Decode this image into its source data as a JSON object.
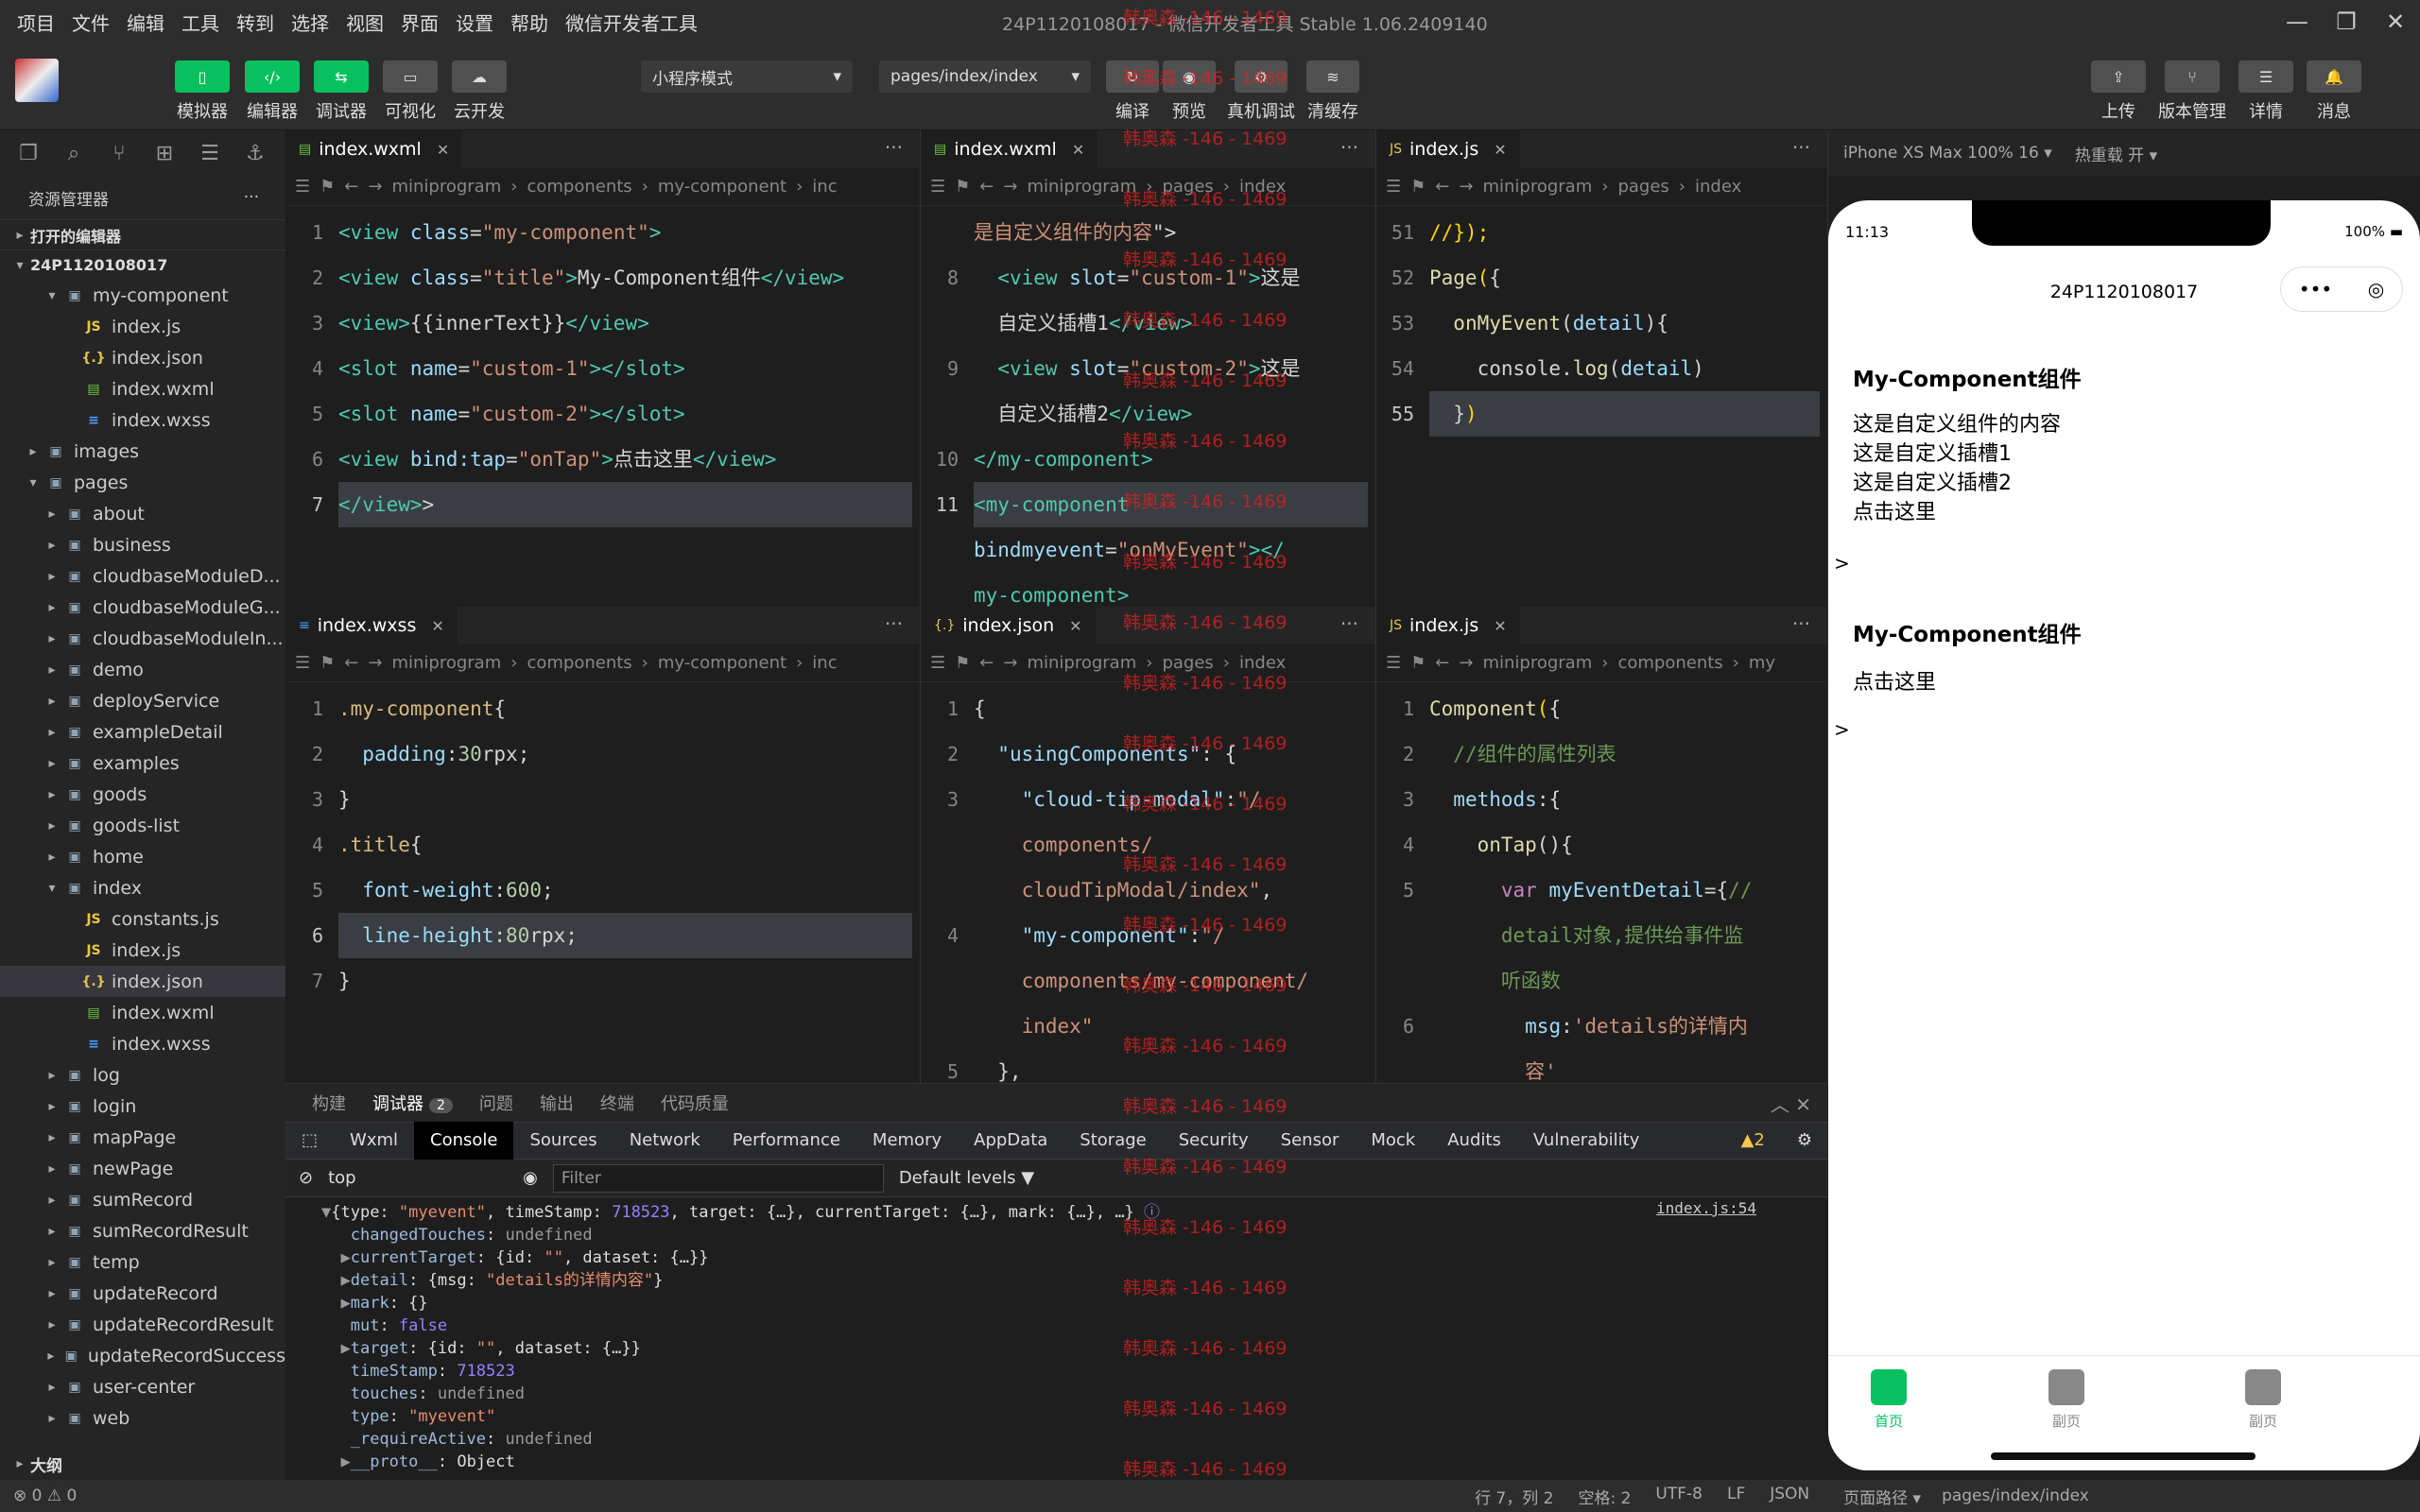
{
  "menu": [
    "项目",
    "文件",
    "编辑",
    "工具",
    "转到",
    "选择",
    "视图",
    "界面",
    "设置",
    "帮助",
    "微信开发者工具"
  ],
  "window_title": "24P1120108017 - 微信开发者工具 Stable 1.06.2409140",
  "toolbar": {
    "left": [
      {
        "icon": "▯",
        "label": "模拟器"
      },
      {
        "icon": "‹/›",
        "label": "编辑器"
      },
      {
        "icon": "⇆",
        "label": "调试器"
      },
      {
        "icon": "▭",
        "label": "可视化"
      },
      {
        "icon": "☁",
        "label": "云开发"
      }
    ],
    "mode": "小程序模式",
    "page": "pages/index/index",
    "mid": [
      {
        "label": "编译"
      },
      {
        "label": "预览"
      },
      {
        "label": "真机调试"
      },
      {
        "label": "清缓存"
      }
    ],
    "right": [
      {
        "label": "上传"
      },
      {
        "label": "版本管理"
      },
      {
        "label": "详情"
      },
      {
        "label": "消息"
      }
    ]
  },
  "explorer": {
    "title": "资源管理器",
    "open_editors": "打开的编辑器",
    "project": "24P1120108017",
    "tree": [
      {
        "name": "my-component",
        "indent": 2,
        "type": "folder",
        "open": true
      },
      {
        "name": "index.js",
        "indent": 3,
        "type": "js"
      },
      {
        "name": "index.json",
        "indent": 3,
        "type": "json"
      },
      {
        "name": "index.wxml",
        "indent": 3,
        "type": "wxml"
      },
      {
        "name": "index.wxss",
        "indent": 3,
        "type": "wxss"
      },
      {
        "name": "images",
        "indent": 1,
        "type": "folder"
      },
      {
        "name": "pages",
        "indent": 1,
        "type": "folder",
        "open": true
      },
      {
        "name": "about",
        "indent": 2,
        "type": "folder"
      },
      {
        "name": "business",
        "indent": 2,
        "type": "folder"
      },
      {
        "name": "cloudbaseModuleD...",
        "indent": 2,
        "type": "folder"
      },
      {
        "name": "cloudbaseModuleG...",
        "indent": 2,
        "type": "folder"
      },
      {
        "name": "cloudbaseModuleIn...",
        "indent": 2,
        "type": "folder"
      },
      {
        "name": "demo",
        "indent": 2,
        "type": "folder"
      },
      {
        "name": "deployService",
        "indent": 2,
        "type": "folder"
      },
      {
        "name": "exampleDetail",
        "indent": 2,
        "type": "folder"
      },
      {
        "name": "examples",
        "indent": 2,
        "type": "folder"
      },
      {
        "name": "goods",
        "indent": 2,
        "type": "folder"
      },
      {
        "name": "goods-list",
        "indent": 2,
        "type": "folder"
      },
      {
        "name": "home",
        "indent": 2,
        "type": "folder"
      },
      {
        "name": "index",
        "indent": 2,
        "type": "folder",
        "open": true
      },
      {
        "name": "constants.js",
        "indent": 3,
        "type": "js"
      },
      {
        "name": "index.js",
        "indent": 3,
        "type": "js"
      },
      {
        "name": "index.json",
        "indent": 3,
        "type": "json",
        "selected": true
      },
      {
        "name": "index.wxml",
        "indent": 3,
        "type": "wxml"
      },
      {
        "name": "index.wxss",
        "indent": 3,
        "type": "wxss"
      },
      {
        "name": "log",
        "indent": 2,
        "type": "folder"
      },
      {
        "name": "login",
        "indent": 2,
        "type": "folder"
      },
      {
        "name": "mapPage",
        "indent": 2,
        "type": "folder"
      },
      {
        "name": "newPage",
        "indent": 2,
        "type": "folder"
      },
      {
        "name": "sumRecord",
        "indent": 2,
        "type": "folder"
      },
      {
        "name": "sumRecordResult",
        "indent": 2,
        "type": "folder"
      },
      {
        "name": "temp",
        "indent": 2,
        "type": "folder"
      },
      {
        "name": "updateRecord",
        "indent": 2,
        "type": "folder"
      },
      {
        "name": "updateRecordResult",
        "indent": 2,
        "type": "folder"
      },
      {
        "name": "updateRecordSuccess",
        "indent": 2,
        "type": "folder"
      },
      {
        "name": "user-center",
        "indent": 2,
        "type": "folder"
      },
      {
        "name": "web",
        "indent": 2,
        "type": "folder"
      }
    ],
    "outline": "大纲"
  },
  "panes": {
    "p1": {
      "tab": "index.wxml",
      "crumb": [
        "miniprogram",
        "components",
        "my-component",
        "inc"
      ],
      "lines": [
        {
          "n": "1",
          "h": "<span class='tag'>&lt;view</span> <span class='attr'>class</span>=<span class='str'>\"my-component\"</span><span class='tag'>&gt;</span>"
        },
        {
          "n": "2",
          "h": "<span class='tag'>&lt;view</span> <span class='attr'>class</span>=<span class='str'>\"title\"</span><span class='tag'>&gt;</span>My-Component组件<span class='tag'>&lt;/view&gt;</span>"
        },
        {
          "n": "3",
          "h": "<span class='tag'>&lt;view&gt;</span>{{innerText}}<span class='tag'>&lt;/view&gt;</span>"
        },
        {
          "n": "4",
          "h": "<span class='tag'>&lt;slot</span> <span class='attr'>name</span>=<span class='str'>\"custom-1\"</span><span class='tag'>&gt;&lt;/slot&gt;</span>"
        },
        {
          "n": "5",
          "h": "<span class='tag'>&lt;slot</span> <span class='attr'>name</span>=<span class='str'>\"custom-2\"</span><span class='tag'>&gt;&lt;/slot&gt;</span>"
        },
        {
          "n": "6",
          "h": "<span class='tag'>&lt;view</span> <span class='attr'>bind:tap</span>=<span class='str'>\"onTap\"</span><span class='tag'>&gt;</span>点击这里<span class='tag'>&lt;/view&gt;</span>"
        },
        {
          "n": "7",
          "h": "<span class='tag'>&lt;/view&gt;</span>&gt;",
          "cur": true
        }
      ]
    },
    "p2": {
      "tab": "index.wxml",
      "crumb": [
        "miniprogram",
        "pages",
        "index"
      ],
      "lines": [
        {
          "n": "",
          "h": "<span class='str'>是自定义组件的内容</span>\"&gt;"
        },
        {
          "n": "8",
          "h": "  <span class='tag'>&lt;view</span> <span class='attr'>slot</span>=<span class='str'>\"custom-1\"</span><span class='tag'>&gt;</span>这是"
        },
        {
          "n": "",
          "h": "  自定义插槽1<span class='tag'>&lt;/view&gt;</span>"
        },
        {
          "n": "9",
          "h": "  <span class='tag'>&lt;view</span> <span class='attr'>slot</span>=<span class='str'>\"custom-2\"</span><span class='tag'>&gt;</span>这是"
        },
        {
          "n": "",
          "h": "  自定义插槽2<span class='tag'>&lt;/view&gt;</span>"
        },
        {
          "n": "10",
          "h": "<span class='tag'>&lt;/my-component&gt;</span>"
        },
        {
          "n": "11",
          "h": "<span class='tag'>&lt;my-component</span>",
          "cur": true
        },
        {
          "n": "",
          "h": "<span class='attr'>bindmyevent</span>=<span class='str'>\"onMyEvent\"</span><span class='tag'>&gt;&lt;/</span>"
        },
        {
          "n": "",
          "h": "<span class='tag'>my-component&gt;</span>"
        }
      ]
    },
    "p3": {
      "tab": "index.js",
      "crumb": [
        "miniprogram",
        "pages",
        "index"
      ],
      "lines": [
        {
          "n": "51",
          "h": "<span class='pl'>//});</span>"
        },
        {
          "n": "52",
          "h": "<span class='fn'>Page</span><span class='pl'>(</span>{"
        },
        {
          "n": "53",
          "h": "  <span class='fn'>onMyEvent</span>(<span class='attr'>detail</span>){"
        },
        {
          "n": "54",
          "h": "    console.<span class='fn'>log</span>(<span class='attr'>detail</span>)"
        },
        {
          "n": "55",
          "h": "  }<span class='pl'>)</span>",
          "cur": true
        }
      ]
    },
    "p4": {
      "tab": "index.wxss",
      "crumb": [
        "miniprogram",
        "components",
        "my-component",
        "inc"
      ],
      "lines": [
        {
          "n": "1",
          "h": "<span class='sel2'>.my-component</span>{"
        },
        {
          "n": "2",
          "h": "  <span class='prop'>padding</span>:<span class='num'>30</span>rpx;"
        },
        {
          "n": "3",
          "h": "}"
        },
        {
          "n": "4",
          "h": "<span class='sel2'>.title</span>{"
        },
        {
          "n": "5",
          "h": "  <span class='prop'>font-weight</span>:<span class='num'>600</span>;"
        },
        {
          "n": "6",
          "h": "  <span class='prop'>line-height</span>:<span class='num'>80</span>rpx;",
          "cur": true
        },
        {
          "n": "7",
          "h": "}"
        }
      ]
    },
    "p5": {
      "tab": "index.json",
      "crumb": [
        "miniprogram",
        "pages",
        "index"
      ],
      "lines": [
        {
          "n": "1",
          "h": "{"
        },
        {
          "n": "2",
          "h": "  <span class='attr'>\"usingComponents\"</span>: {"
        },
        {
          "n": "3",
          "h": "    <span class='attr'>\"cloud-tip-modal\"</span>:<span class='str'>\"/</span>"
        },
        {
          "n": "",
          "h": "    <span class='str'>components/</span>"
        },
        {
          "n": "",
          "h": "    <span class='str'>cloudTipModal/index\"</span>,"
        },
        {
          "n": "4",
          "h": "    <span class='attr'>\"my-component\"</span>:<span class='str'>\"/</span>"
        },
        {
          "n": "",
          "h": "    <span class='str'>components/my-component/</span>"
        },
        {
          "n": "",
          "h": "    <span class='str'>index\"</span>"
        },
        {
          "n": "5",
          "h": "  },"
        }
      ]
    },
    "p6": {
      "tab": "index.js",
      "crumb": [
        "miniprogram",
        "components",
        "my"
      ],
      "lines": [
        {
          "n": "1",
          "h": "<span class='fn'>Component</span><span class='pl'>(</span>{"
        },
        {
          "n": "2",
          "h": "  <span class='cm'>//组件的属性列表</span>"
        },
        {
          "n": "3",
          "h": "  <span class='attr'>methods</span>:{"
        },
        {
          "n": "4",
          "h": "    <span class='fn'>onTap</span>(){"
        },
        {
          "n": "5",
          "h": "      <span class='kw'>var</span> <span class='attr'>myEventDetail</span>={<span class='cm'>//</span>"
        },
        {
          "n": "",
          "h": "      <span class='cm'>detail对象,提供给事件监</span>"
        },
        {
          "n": "",
          "h": "      <span class='cm'>听函数</span>"
        },
        {
          "n": "6",
          "h": "        <span class='attr'>msg</span>:<span class='str'>'details的详情内</span>"
        },
        {
          "n": "",
          "h": "        <span class='str'>容'</span>"
        }
      ]
    }
  },
  "panel": {
    "tabs": [
      "构建",
      "调试器",
      "问题",
      "输出",
      "终端",
      "代码质量"
    ],
    "badge": "2",
    "devtabs": [
      "Wxml",
      "Console",
      "Sources",
      "Network",
      "Performance",
      "Memory",
      "AppData",
      "Storage",
      "Security",
      "Sensor",
      "Mock",
      "Audits",
      "Vulnerability"
    ],
    "warn": "▲2",
    "context": "top",
    "filter": "Filter",
    "levels": "Default levels ▼",
    "source": "index.js:54",
    "log": [
      "<span class='cg'>▼</span>{type: <span class='cs'>\"myevent\"</span>, timeStamp: <span class='cn'>718523</span>, target: {…}, currentTarget: {…}, mark: {…}, …} <span class='cn'>ⓘ</span>",
      "   <span class='ck'>changedTouches</span>: <span class='cg'>undefined</span>",
      "  <span class='cg'>▶</span><span class='ck'>currentTarget</span>: {id: <span class='cs'>\"\"</span>, dataset: {…}}",
      "  <span class='cg'>▶</span><span class='ck'>detail</span>: {msg: <span class='cs'>\"details的详情内容\"</span>}",
      "  <span class='cg'>▶</span><span class='ck'>mark</span>: {}",
      "   <span class='ck'>mut</span>: <span class='cn'>false</span>",
      "  <span class='cg'>▶</span><span class='ck'>target</span>: {id: <span class='cs'>\"\"</span>, dataset: {…}}",
      "   <span class='ck'>timeStamp</span>: <span class='cn'>718523</span>",
      "   <span class='ck'>touches</span>: <span class='cg'>undefined</span>",
      "   <span class='ck'>type</span>: <span class='cs'>\"myevent\"</span>",
      "   <span class='ck'>_requireActive</span>: <span class='cg'>undefined</span>",
      "  <span class='cg'>▶</span><span class='ck'>__proto__</span>: Object"
    ]
  },
  "simulator": {
    "device": "iPhone XS Max 100% 16 ▾",
    "hotreload": "热重载 开 ▾",
    "time": "11:13",
    "battery": "100%",
    "nav_title": "24P1120108017",
    "block1_title": "My-Component组件",
    "block1_lines": [
      "这是自定义组件的内容",
      "这是自定义插槽1",
      "这是自定义插槽2",
      "点击这里"
    ],
    "gt": ">",
    "block2_title": "My-Component组件",
    "block2_line": "点击这里",
    "tabs": [
      {
        "label": "首页",
        "color": "#07c160"
      },
      {
        "label": "副页",
        "color": "#888888"
      },
      {
        "label": "副页",
        "color": "#888888"
      }
    ]
  },
  "status": {
    "left": "⊗ 0 ⚠ 0",
    "items": [
      "行 7，列 2",
      "空格: 2",
      "UTF-8",
      "LF",
      "JSON"
    ],
    "route_label": "页面路径 ▾",
    "route": "pages/index/index"
  },
  "watermark": "韩奥森 -146 - 1469",
  "colors": {
    "accent": "#07c160",
    "bg": "#1e1e1e"
  }
}
